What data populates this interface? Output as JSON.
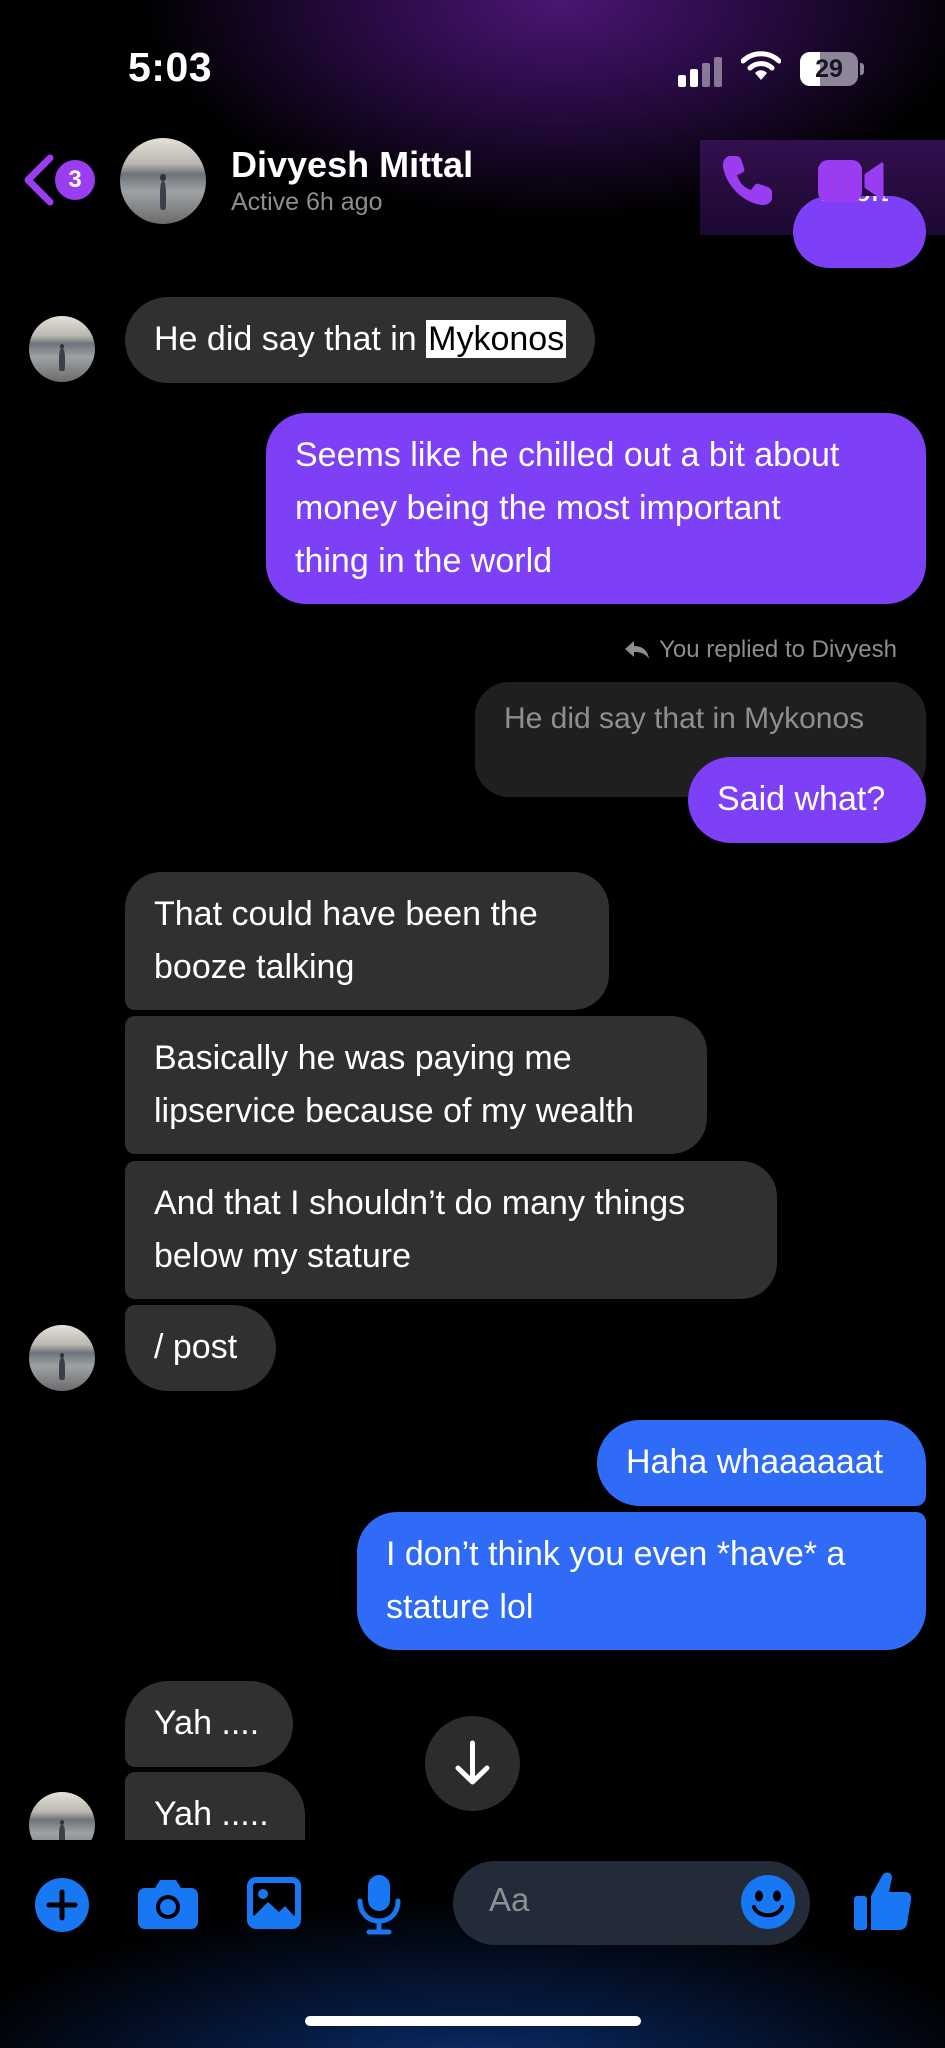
{
  "status_bar": {
    "time": "5:03",
    "battery": "29"
  },
  "header": {
    "unread_count": "3",
    "contact_name": "Divyesh Mittal",
    "contact_status": "Active 6h ago"
  },
  "conversation": {
    "partial_top": "A bit",
    "msg_mykonos_prefix": "He did say that in ",
    "msg_mykonos_highlight": "Mykonos",
    "msg_chilled": [
      "Seems like he chilled out a bit about",
      "money being the most important",
      "thing in the world"
    ],
    "reply_label": "You replied to Divyesh",
    "quoted_text": "He did say that in Mykonos",
    "msg_said_what": "Said what?",
    "msg_booze": [
      "That could have been the",
      "booze talking"
    ],
    "msg_lipservice": [
      "Basically he was paying me",
      "lipservice because of my wealth"
    ],
    "msg_stature": [
      "And that I shouldn’t do many things",
      "below my stature"
    ],
    "msg_post": "/ post",
    "msg_haha": "Haha whaaaaaat",
    "msg_dont_think": [
      "I don’t think you even *have* a",
      "stature lol"
    ],
    "msg_yah1": "Yah ....",
    "msg_yah2": "Yah ....."
  },
  "composer": {
    "placeholder": "Aa"
  },
  "colors": {
    "outgoing_purple": "#7d40f7",
    "outgoing_blue": "#2f6bf7",
    "incoming": "#303030",
    "accent": "#9a3cf0",
    "toolbar_blue": "#1877f2"
  },
  "icons": {
    "header": [
      "chevron-left-icon",
      "phone-icon",
      "video-camera-icon"
    ],
    "toolbar": [
      "plus-icon",
      "camera-icon",
      "gallery-icon",
      "microphone-icon",
      "emoji-icon",
      "thumbs-up-icon"
    ]
  }
}
